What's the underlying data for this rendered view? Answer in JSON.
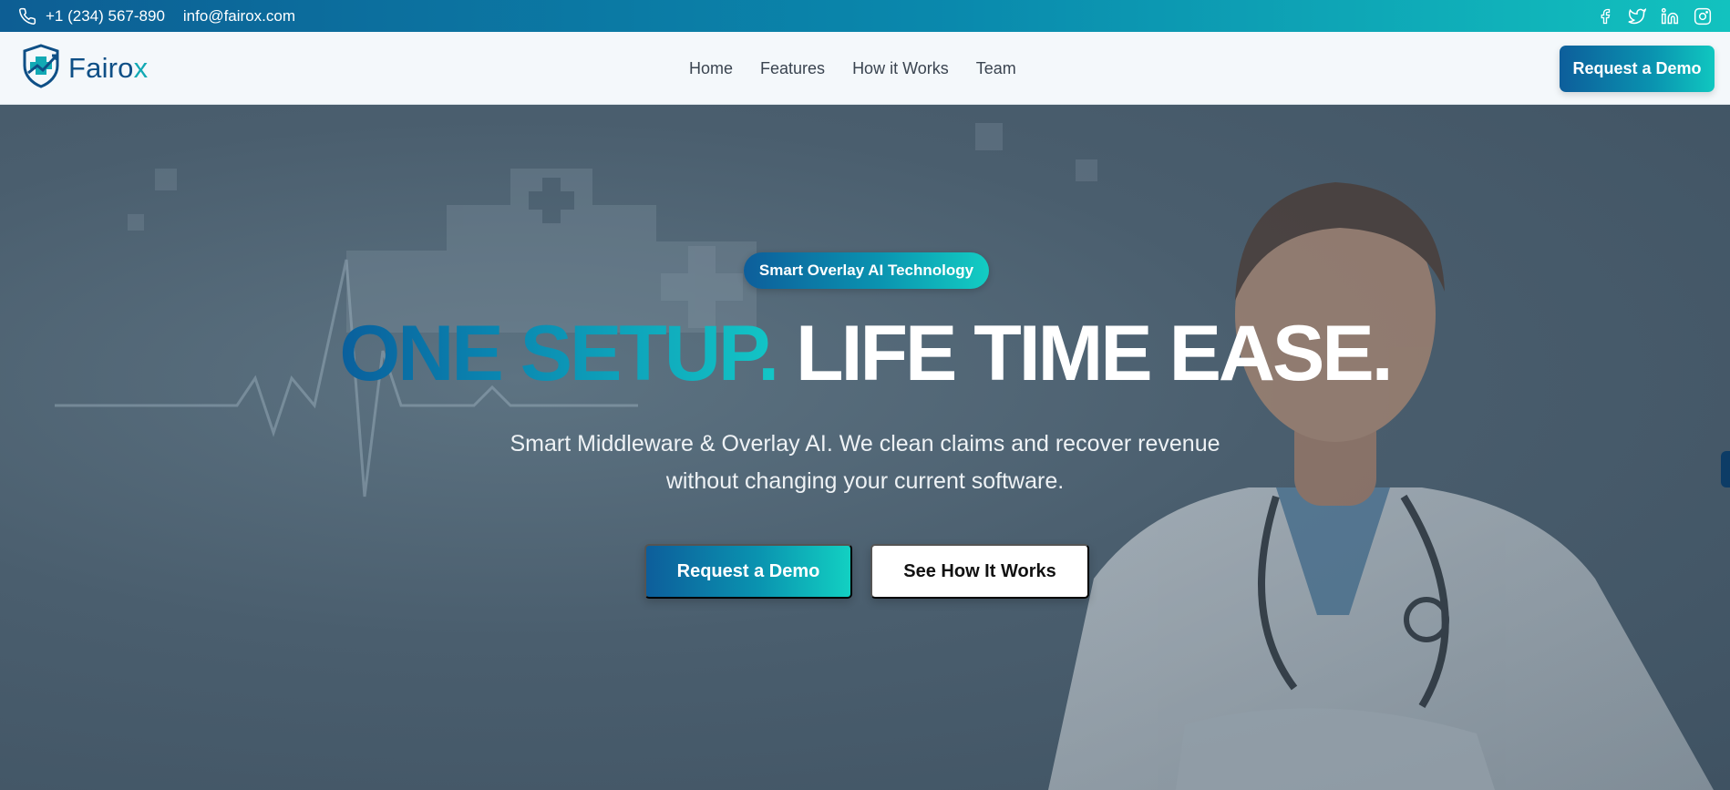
{
  "topbar": {
    "phone": "+1 (234) 567-890",
    "email": "info@fairox.com",
    "socials": [
      "facebook-icon",
      "twitter-icon",
      "linkedin-icon",
      "instagram-icon"
    ]
  },
  "navbar": {
    "logo": {
      "text_main": "Fairo",
      "text_accent": "x"
    },
    "links": [
      "Home",
      "Features",
      "How it Works",
      "Team"
    ],
    "cta": "Request a Demo"
  },
  "hero": {
    "badge": "Smart Overlay AI Technology",
    "headline_gradient": "ONE SETUP.",
    "headline_white": "LIFE TIME EASE.",
    "subtext_line1": "Smart Middleware & Overlay AI. We clean claims and recover revenue",
    "subtext_line2": "without changing your current software.",
    "cta_primary": "Request a Demo",
    "cta_secondary": "See How It Works"
  },
  "colors": {
    "brand_dark": "#0d5e9b",
    "brand_teal": "#12c6c4",
    "hero_overlay": "#4a5e6e"
  }
}
